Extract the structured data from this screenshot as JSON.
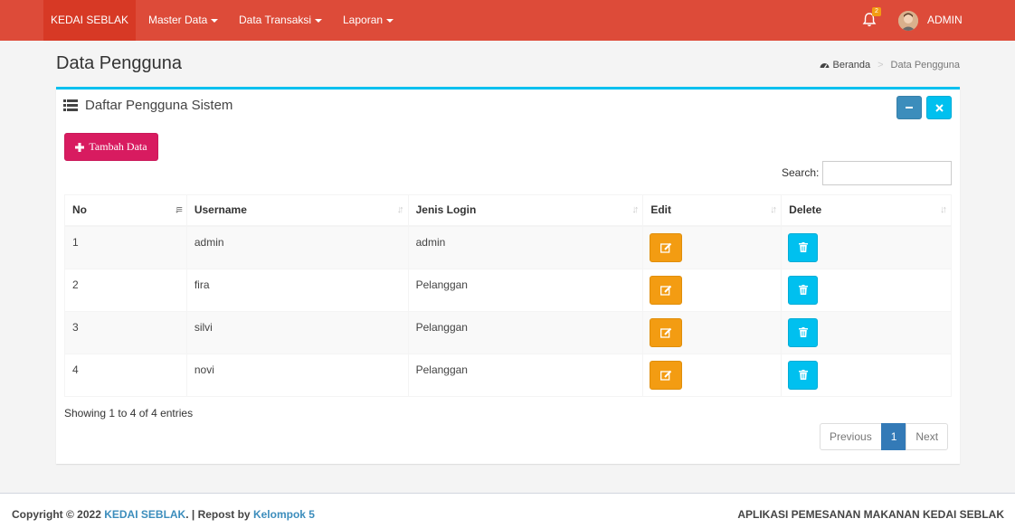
{
  "navbar": {
    "brand": "KEDAI SEBLAK",
    "menus": [
      "Master Data",
      "Data Transaksi",
      "Laporan"
    ],
    "notification_count": "2",
    "user": "ADMIN"
  },
  "header": {
    "title": "Data Pengguna",
    "breadcrumb": [
      "Beranda",
      "Data Pengguna"
    ]
  },
  "box": {
    "title": "Daftar Pengguna Sistem",
    "add_button": "Tambah Data",
    "search_label": "Search:",
    "search_value": ""
  },
  "table": {
    "columns": [
      "No",
      "Username",
      "Jenis Login",
      "Edit",
      "Delete"
    ],
    "rows": [
      {
        "no": "1",
        "username": "admin",
        "login": "admin"
      },
      {
        "no": "2",
        "username": "fira",
        "login": "Pelanggan"
      },
      {
        "no": "3",
        "username": "silvi",
        "login": "Pelanggan"
      },
      {
        "no": "4",
        "username": "novi",
        "login": "Pelanggan"
      }
    ]
  },
  "footer_info": "Showing 1 to 4 of 4 entries",
  "pagination": {
    "previous": "Previous",
    "current": "1",
    "next": "Next"
  },
  "footer": {
    "copyright_prefix": "Copyright © 2022",
    "brand_link": "KEDAI SEBLAK",
    "repost_text": ". | Repost by",
    "team_link": "Kelompok 5",
    "app_name": "APLIKASI PEMESANAN MAKANAN KEDAI SEBLAK"
  },
  "colors": {
    "navbar": "#dd4b39",
    "box_accent": "#00c0ef",
    "add_button": "#d81b60",
    "edit_button": "#f39c12",
    "delete_button": "#00c0ef",
    "pagination_active": "#337ab7"
  },
  "icons": {
    "notifications": "bell-icon",
    "breadcrumb_home": "dashboard-icon",
    "box_title": "list-icon",
    "add": "plus-icon",
    "minimize": "minus-icon",
    "close": "close-icon",
    "edit": "edit-icon",
    "delete": "trash-icon",
    "sort": "sort-icon"
  }
}
